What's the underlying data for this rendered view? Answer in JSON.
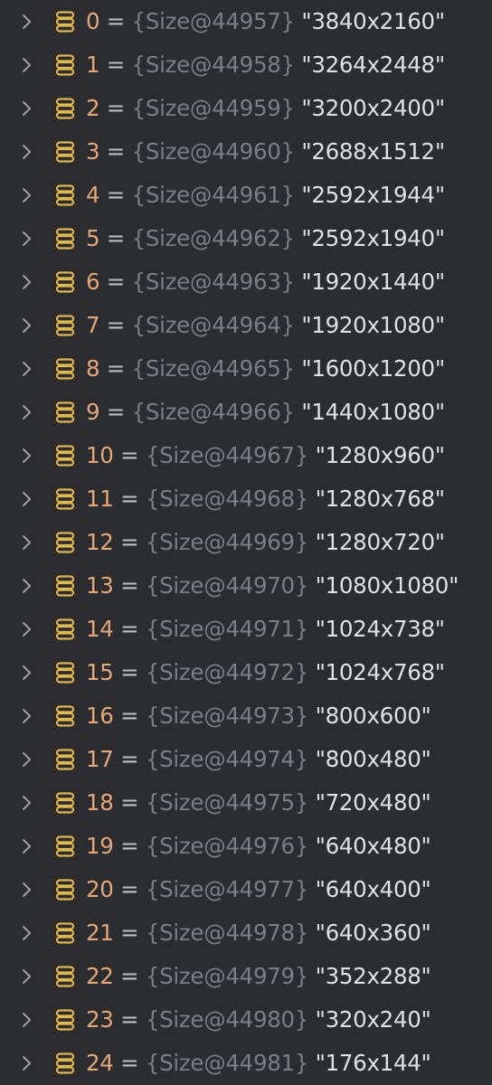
{
  "theme": {
    "background": "#2b2d30",
    "index_color": "#e6a775",
    "equals_color": "#bcbec4",
    "object_ref_color": "#7a7e85",
    "value_color": "#dfe1e5",
    "field_icon_color": "#e5b64a",
    "chevron_color": "#9da0a8"
  },
  "icons": {
    "expand": "chevron-right-icon",
    "element": "array-element-icon"
  },
  "variables": [
    {
      "index": "0",
      "equals": "=",
      "ref": "{Size@44957}",
      "value": "\"3840x2160\""
    },
    {
      "index": "1",
      "equals": "=",
      "ref": "{Size@44958}",
      "value": "\"3264x2448\""
    },
    {
      "index": "2",
      "equals": "=",
      "ref": "{Size@44959}",
      "value": "\"3200x2400\""
    },
    {
      "index": "3",
      "equals": "=",
      "ref": "{Size@44960}",
      "value": "\"2688x1512\""
    },
    {
      "index": "4",
      "equals": "=",
      "ref": "{Size@44961}",
      "value": "\"2592x1944\""
    },
    {
      "index": "5",
      "equals": "=",
      "ref": "{Size@44962}",
      "value": "\"2592x1940\""
    },
    {
      "index": "6",
      "equals": "=",
      "ref": "{Size@44963}",
      "value": "\"1920x1440\""
    },
    {
      "index": "7",
      "equals": "=",
      "ref": "{Size@44964}",
      "value": "\"1920x1080\""
    },
    {
      "index": "8",
      "equals": "=",
      "ref": "{Size@44965}",
      "value": "\"1600x1200\""
    },
    {
      "index": "9",
      "equals": "=",
      "ref": "{Size@44966}",
      "value": "\"1440x1080\""
    },
    {
      "index": "10",
      "equals": "=",
      "ref": "{Size@44967}",
      "value": "\"1280x960\""
    },
    {
      "index": "11",
      "equals": "=",
      "ref": "{Size@44968}",
      "value": "\"1280x768\""
    },
    {
      "index": "12",
      "equals": "=",
      "ref": "{Size@44969}",
      "value": "\"1280x720\""
    },
    {
      "index": "13",
      "equals": "=",
      "ref": "{Size@44970}",
      "value": "\"1080x1080\""
    },
    {
      "index": "14",
      "equals": "=",
      "ref": "{Size@44971}",
      "value": "\"1024x738\""
    },
    {
      "index": "15",
      "equals": "=",
      "ref": "{Size@44972}",
      "value": "\"1024x768\""
    },
    {
      "index": "16",
      "equals": "=",
      "ref": "{Size@44973}",
      "value": "\"800x600\""
    },
    {
      "index": "17",
      "equals": "=",
      "ref": "{Size@44974}",
      "value": "\"800x480\""
    },
    {
      "index": "18",
      "equals": "=",
      "ref": "{Size@44975}",
      "value": "\"720x480\""
    },
    {
      "index": "19",
      "equals": "=",
      "ref": "{Size@44976}",
      "value": "\"640x480\""
    },
    {
      "index": "20",
      "equals": "=",
      "ref": "{Size@44977}",
      "value": "\"640x400\""
    },
    {
      "index": "21",
      "equals": "=",
      "ref": "{Size@44978}",
      "value": "\"640x360\""
    },
    {
      "index": "22",
      "equals": "=",
      "ref": "{Size@44979}",
      "value": "\"352x288\""
    },
    {
      "index": "23",
      "equals": "=",
      "ref": "{Size@44980}",
      "value": "\"320x240\""
    },
    {
      "index": "24",
      "equals": "=",
      "ref": "{Size@44981}",
      "value": "\"176x144\""
    }
  ]
}
